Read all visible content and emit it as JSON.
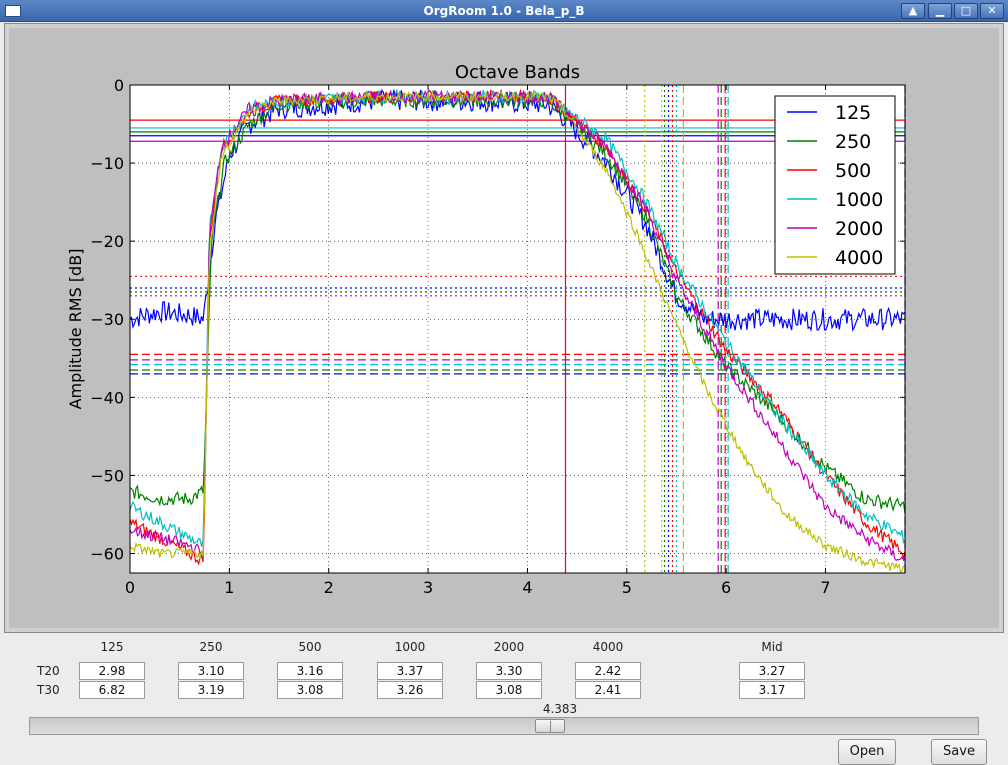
{
  "window": {
    "title": "OrgRoom 1.0 - Bela_p_B",
    "buttons": [
      {
        "name": "window-raise-button",
        "glyph": "▲"
      },
      {
        "name": "window-minimize-button",
        "glyph": "▁"
      },
      {
        "name": "window-maximize-button",
        "glyph": "□"
      },
      {
        "name": "window-close-button",
        "glyph": "✕"
      }
    ]
  },
  "chart_data": {
    "type": "line",
    "title": "Octave Bands",
    "xlabel": "",
    "ylabel": "Amplitude RMS [dB]",
    "xlim": [
      0,
      7.8
    ],
    "ylim": [
      -62.5,
      0
    ],
    "xticks": [
      0,
      1,
      2,
      3,
      4,
      5,
      6,
      7
    ],
    "yticks": [
      0,
      -10,
      -20,
      -30,
      -40,
      -50,
      -60
    ],
    "grid": true,
    "legend_position": "top-right",
    "series": [
      {
        "name": "125",
        "color": "#0000ff",
        "noise": 1.4,
        "x": [
          0,
          0.3,
          0.6,
          0.74,
          0.85,
          1.0,
          1.2,
          1.5,
          2.5,
          3.5,
          4.2,
          4.35,
          4.8,
          5.2,
          5.5,
          5.8,
          6.5,
          7.0,
          7.8
        ],
        "y": [
          -30,
          -29,
          -29.5,
          -30,
          -18,
          -9,
          -5,
          -3,
          -2,
          -2,
          -2.5,
          -4,
          -10,
          -18,
          -27,
          -30,
          -30,
          -30,
          -30
        ]
      },
      {
        "name": "250",
        "color": "#008000",
        "noise": 0.9,
        "x": [
          0,
          0.3,
          0.6,
          0.74,
          0.82,
          0.95,
          1.2,
          1.5,
          2.5,
          3.5,
          4.2,
          4.35,
          4.8,
          5.2,
          5.5,
          6.0,
          6.5,
          7.0,
          7.4,
          7.8
        ],
        "y": [
          -52,
          -53,
          -53,
          -52,
          -20,
          -10,
          -5,
          -2.5,
          -2,
          -2,
          -2,
          -3.5,
          -9,
          -17,
          -27,
          -36,
          -42,
          -49,
          -53,
          -54
        ]
      },
      {
        "name": "500",
        "color": "#ff0000",
        "noise": 0.8,
        "x": [
          0,
          0.3,
          0.6,
          0.74,
          0.8,
          0.92,
          1.2,
          1.5,
          2.5,
          3.5,
          4.2,
          4.35,
          4.8,
          5.2,
          5.5,
          6.0,
          6.5,
          7.0,
          7.4,
          7.8
        ],
        "y": [
          -56,
          -58,
          -60,
          -61,
          -20,
          -8,
          -3.5,
          -2,
          -1.5,
          -1.5,
          -1.5,
          -3,
          -8,
          -16,
          -24,
          -34,
          -41,
          -50,
          -56,
          -60
        ]
      },
      {
        "name": "1000",
        "color": "#00bfbf",
        "noise": 0.8,
        "x": [
          0,
          0.3,
          0.6,
          0.74,
          0.8,
          0.92,
          1.2,
          1.5,
          2.5,
          3.5,
          4.2,
          4.35,
          4.8,
          5.2,
          5.5,
          6.0,
          6.5,
          7.0,
          7.4,
          7.8
        ],
        "y": [
          -54,
          -56,
          -58,
          -59,
          -18,
          -8,
          -3,
          -2,
          -1.5,
          -1.5,
          -1.5,
          -3,
          -7,
          -15,
          -23,
          -33,
          -42,
          -50,
          -55,
          -58
        ]
      },
      {
        "name": "2000",
        "color": "#bf00bf",
        "noise": 0.8,
        "x": [
          0,
          0.3,
          0.6,
          0.74,
          0.8,
          0.92,
          1.2,
          1.5,
          2.5,
          3.5,
          4.2,
          4.35,
          4.8,
          5.2,
          5.5,
          6.0,
          6.5,
          7.0,
          7.4,
          7.8
        ],
        "y": [
          -57,
          -58,
          -59,
          -60,
          -19,
          -8,
          -3,
          -2,
          -1.5,
          -1.5,
          -1.5,
          -3,
          -8,
          -16,
          -25,
          -36,
          -45,
          -54,
          -58,
          -61
        ]
      },
      {
        "name": "4000",
        "color": "#bfbf00",
        "noise": 0.6,
        "x": [
          0,
          0.3,
          0.6,
          0.74,
          0.8,
          0.92,
          1.2,
          1.5,
          2.5,
          3.5,
          4.2,
          4.35,
          4.8,
          5.1,
          5.4,
          5.8,
          6.2,
          6.6,
          7.0,
          7.4,
          7.8
        ],
        "y": [
          -59,
          -60,
          -60,
          -60,
          -21,
          -9,
          -3.5,
          -2,
          -1.5,
          -1.5,
          -1.5,
          -3,
          -11,
          -19,
          -28,
          -39,
          -48,
          -55,
          -59,
          -61,
          -62
        ]
      }
    ],
    "horizontal_lines": [
      {
        "y": -4.5,
        "color": "#ff0000",
        "style": "solid"
      },
      {
        "y": -5.5,
        "color": "#00bfbf",
        "style": "solid"
      },
      {
        "y": -6.0,
        "color": "#008000",
        "style": "solid"
      },
      {
        "y": -6.5,
        "color": "#0000ff",
        "style": "solid"
      },
      {
        "y": -7.2,
        "color": "#bf00bf",
        "style": "solid"
      },
      {
        "y": -24.5,
        "color": "#ff0000",
        "style": "dotted"
      },
      {
        "y": -26.0,
        "color": "#0000ff",
        "style": "dotted"
      },
      {
        "y": -26.5,
        "color": "#008000",
        "style": "dotted"
      },
      {
        "y": -27.0,
        "color": "#bf00bf",
        "style": "dotted"
      },
      {
        "y": -34.5,
        "color": "#ff0000",
        "style": "dashed"
      },
      {
        "y": -35.2,
        "color": "#bf00bf",
        "style": "dashed"
      },
      {
        "y": -35.8,
        "color": "#00bfbf",
        "style": "dashed"
      },
      {
        "y": -36.5,
        "color": "#008000",
        "style": "dashed"
      },
      {
        "y": -37.0,
        "color": "#0000ff",
        "style": "dashed"
      }
    ],
    "vertical_lines": [
      {
        "x": 4.383,
        "color": "#ff0000",
        "style": "solid"
      },
      {
        "x": 7.8,
        "color": "#0000ff",
        "style": "dashed"
      },
      {
        "x": 5.18,
        "color": "#bfbf00",
        "style": "dotted"
      },
      {
        "x": 5.35,
        "color": "#bfbf00",
        "style": "dotted"
      },
      {
        "x": 5.38,
        "color": "#008000",
        "style": "dotted"
      },
      {
        "x": 5.42,
        "color": "#0000ff",
        "style": "dotted"
      },
      {
        "x": 5.46,
        "color": "#ff0000",
        "style": "dotted"
      },
      {
        "x": 5.5,
        "color": "#00bfbf",
        "style": "dotted"
      },
      {
        "x": 5.57,
        "color": "#bfbf00",
        "style": "dashed"
      },
      {
        "x": 5.92,
        "color": "#bf00bf",
        "style": "dashed"
      },
      {
        "x": 5.95,
        "color": "#008000",
        "style": "dashed"
      },
      {
        "x": 5.99,
        "color": "#ff0000",
        "style": "dashed"
      },
      {
        "x": 6.02,
        "color": "#00bfbf",
        "style": "dashed"
      }
    ]
  },
  "bands": [
    "125",
    "250",
    "500",
    "1000",
    "2000",
    "4000"
  ],
  "mid_label": "Mid",
  "rows": [
    {
      "label": "T20",
      "values": [
        "2.98",
        "3.10",
        "3.16",
        "3.37",
        "3.30",
        "2.42"
      ],
      "mid": "3.27"
    },
    {
      "label": "T30",
      "values": [
        "6.82",
        "3.19",
        "3.08",
        "3.26",
        "3.08",
        "2.41"
      ],
      "mid": "3.17"
    }
  ],
  "slider": {
    "value": "4.383",
    "fraction": 0.55
  },
  "buttons": {
    "open": "Open",
    "save": "Save"
  }
}
